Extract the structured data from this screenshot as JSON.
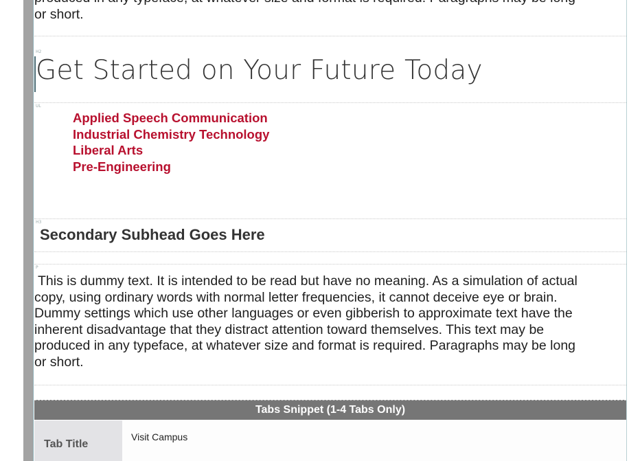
{
  "top_paragraph": {
    "line_partial": "produced in any typeface, at whatever size and format is required. Paragraphs may be long",
    "line_end": "or short."
  },
  "labels": {
    "h2": "H2",
    "ul": "UL",
    "h3": "H3",
    "p": "P"
  },
  "heading": "Get Started on Your Future Today",
  "links": [
    "Applied Speech Communication",
    "Industrial Chemistry Technology",
    "Liberal Arts",
    "Pre-Engineering"
  ],
  "subhead": "Secondary Subhead Goes Here",
  "body_paragraph_lines": [
    "This is dummy text. It is intended to be read but have no meaning. As a simulation of actual",
    "copy, using ordinary words with normal letter frequencies, it cannot deceive eye or brain.",
    "Dummy settings which use other languages or even gibberish to approximate text have the",
    "inherent disadvantage that they distract attention toward themselves. This text may be",
    "produced in any typeface, at whatever size and format is required. Paragraphs may be long",
    "or short."
  ],
  "tabs_snippet": {
    "header": "Tabs Snippet (1-4 Tabs Only)",
    "row_label": "Tab Title",
    "row_value": "Visit Campus"
  },
  "colors": {
    "link": "#b8102e",
    "tabs_header": "#767676",
    "gutter": "#a3a3a3"
  }
}
